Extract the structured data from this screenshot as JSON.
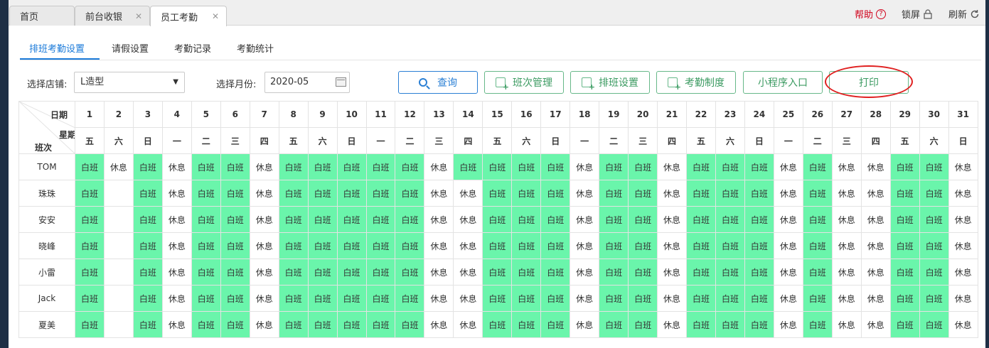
{
  "tabs": [
    {
      "label": "首页",
      "closable": false
    },
    {
      "label": "前台收银",
      "closable": true
    },
    {
      "label": "员工考勤",
      "closable": true,
      "active": true
    }
  ],
  "toolbar": {
    "help": "帮助",
    "lock": "锁屏",
    "refresh": "刷新"
  },
  "subtabs": [
    "排班考勤设置",
    "请假设置",
    "考勤记录",
    "考勤统计"
  ],
  "filters": {
    "store_label": "选择店铺:",
    "store_value": "L造型",
    "month_label": "选择月份:",
    "month_value": "2020-05"
  },
  "buttons": {
    "query": "查询",
    "shift_manage": "班次管理",
    "schedule_setting": "排班设置",
    "attendance_rule": "考勤制度",
    "miniapp": "小程序入口",
    "print": "打印"
  },
  "grid": {
    "header_date": "日期",
    "header_week": "星期",
    "header_shift": "班次",
    "dates": [
      "1",
      "2",
      "3",
      "4",
      "5",
      "6",
      "7",
      "8",
      "9",
      "10",
      "11",
      "12",
      "13",
      "14",
      "15",
      "16",
      "17",
      "18",
      "19",
      "20",
      "21",
      "22",
      "23",
      "24",
      "25",
      "26",
      "27",
      "28",
      "29",
      "30",
      "31"
    ],
    "weekdays": [
      "五",
      "六",
      "日",
      "一",
      "二",
      "三",
      "四",
      "五",
      "六",
      "日",
      "一",
      "二",
      "三",
      "四",
      "五",
      "六",
      "日",
      "一",
      "二",
      "三",
      "四",
      "五",
      "六",
      "日",
      "一",
      "二",
      "三",
      "四",
      "五",
      "六",
      "日"
    ],
    "day_label": "白班",
    "off_label": "休息",
    "employees": [
      {
        "name": "TOM",
        "shifts": [
          "D",
          "O",
          "D",
          "O",
          "D",
          "D",
          "O",
          "D",
          "D",
          "D",
          "D",
          "D",
          "O",
          "D",
          "D",
          "D",
          "D",
          "O",
          "D",
          "D",
          "O",
          "D",
          "D",
          "D",
          "O",
          "D",
          "O",
          "O",
          "D",
          "D",
          "O"
        ]
      },
      {
        "name": "珠珠",
        "shifts": [
          "D",
          "",
          "D",
          "O",
          "D",
          "D",
          "O",
          "D",
          "D",
          "D",
          "D",
          "D",
          "O",
          "O",
          "D",
          "D",
          "D",
          "O",
          "D",
          "D",
          "O",
          "D",
          "D",
          "D",
          "O",
          "D",
          "O",
          "O",
          "D",
          "D",
          "O"
        ]
      },
      {
        "name": "安安",
        "shifts": [
          "D",
          "",
          "D",
          "O",
          "D",
          "D",
          "O",
          "D",
          "D",
          "D",
          "D",
          "D",
          "O",
          "O",
          "D",
          "D",
          "D",
          "O",
          "D",
          "D",
          "O",
          "D",
          "D",
          "D",
          "O",
          "D",
          "O",
          "O",
          "D",
          "D",
          "O"
        ]
      },
      {
        "name": "晓峰",
        "shifts": [
          "D",
          "",
          "D",
          "O",
          "D",
          "D",
          "O",
          "D",
          "D",
          "D",
          "D",
          "D",
          "O",
          "O",
          "D",
          "D",
          "D",
          "O",
          "D",
          "D",
          "O",
          "D",
          "D",
          "D",
          "O",
          "D",
          "O",
          "O",
          "D",
          "D",
          "O"
        ]
      },
      {
        "name": "小雷",
        "shifts": [
          "D",
          "",
          "D",
          "O",
          "D",
          "D",
          "O",
          "D",
          "D",
          "D",
          "D",
          "D",
          "O",
          "O",
          "D",
          "D",
          "D",
          "O",
          "D",
          "D",
          "O",
          "D",
          "D",
          "D",
          "O",
          "D",
          "O",
          "O",
          "D",
          "D",
          "O"
        ]
      },
      {
        "name": "Jack",
        "shifts": [
          "D",
          "",
          "D",
          "O",
          "D",
          "D",
          "O",
          "D",
          "D",
          "D",
          "D",
          "D",
          "O",
          "O",
          "D",
          "D",
          "D",
          "O",
          "D",
          "D",
          "O",
          "D",
          "D",
          "D",
          "O",
          "D",
          "O",
          "O",
          "D",
          "D",
          "O"
        ]
      },
      {
        "name": "夏美",
        "shifts": [
          "D",
          "",
          "D",
          "O",
          "D",
          "D",
          "O",
          "D",
          "D",
          "D",
          "D",
          "D",
          "O",
          "O",
          "D",
          "D",
          "D",
          "O",
          "D",
          "D",
          "O",
          "D",
          "D",
          "D",
          "O",
          "D",
          "O",
          "O",
          "D",
          "D",
          "O"
        ]
      }
    ]
  },
  "colors": {
    "day_shift": "#6af5ab",
    "accent": "#1a7ad9",
    "help": "#d0021b"
  }
}
